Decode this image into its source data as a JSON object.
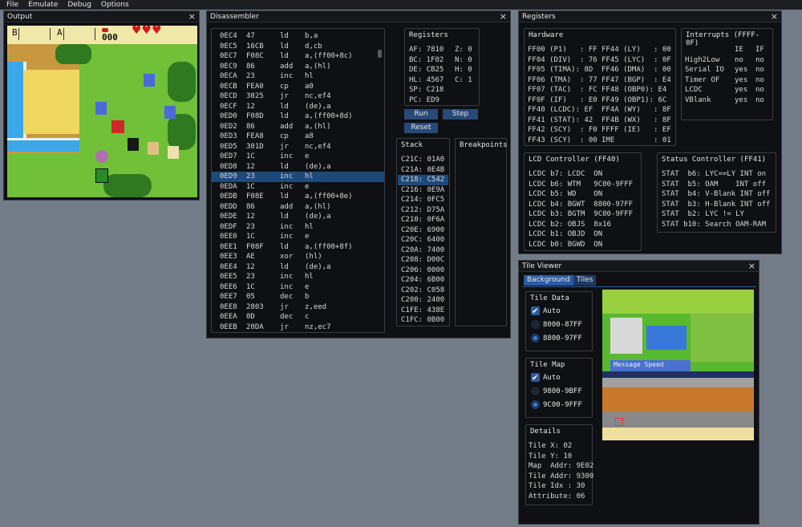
{
  "menu": [
    "File",
    "Emulate",
    "Debug",
    "Options"
  ],
  "output": {
    "title": "Output",
    "close": "×",
    "hud": {
      "b_label": "B",
      "a_label": "A",
      "rupees": "000",
      "hearts": "♥♥♥"
    }
  },
  "disassembler": {
    "title": "Disassembler",
    "close": "×",
    "rows": [
      [
        "0EC4",
        "47",
        "ld",
        "b,a"
      ],
      [
        "0EC5",
        "16CB",
        "ld",
        "d,cb"
      ],
      [
        "0EC7",
        "F08C",
        "ld",
        "a,(ff00+8c)"
      ],
      [
        "0EC9",
        "86",
        "add",
        "a,(hl)"
      ],
      [
        "0ECA",
        "23",
        "inc",
        "hl"
      ],
      [
        "0ECB",
        "FEA0",
        "cp",
        "a0"
      ],
      [
        "0ECD",
        "3025",
        "jr",
        "nc,ef4"
      ],
      [
        "0ECF",
        "12",
        "ld",
        "(de),a"
      ],
      [
        "0ED0",
        "F08D",
        "ld",
        "a,(ff00+8d)"
      ],
      [
        "0ED2",
        "86",
        "add",
        "a,(hl)"
      ],
      [
        "0ED3",
        "FEA8",
        "cp",
        "a8"
      ],
      [
        "0ED5",
        "301D",
        "jr",
        "nc,ef4"
      ],
      [
        "0ED7",
        "1C",
        "inc",
        "e"
      ],
      [
        "0ED8",
        "12",
        "ld",
        "(de),a"
      ],
      [
        "0ED9",
        "23",
        "inc",
        "hl"
      ],
      [
        "0EDA",
        "1C",
        "inc",
        "e"
      ],
      [
        "0EDB",
        "F08E",
        "ld",
        "a,(ff00+8e)"
      ],
      [
        "0EDD",
        "86",
        "add",
        "a,(hl)"
      ],
      [
        "0EDE",
        "12",
        "ld",
        "(de),a"
      ],
      [
        "0EDF",
        "23",
        "inc",
        "hl"
      ],
      [
        "0EE0",
        "1C",
        "inc",
        "e"
      ],
      [
        "0EE1",
        "F08F",
        "ld",
        "a,(ff00+8f)"
      ],
      [
        "0EE3",
        "AE",
        "xor",
        "(hl)"
      ],
      [
        "0EE4",
        "12",
        "ld",
        "(de),a"
      ],
      [
        "0EE5",
        "23",
        "inc",
        "hl"
      ],
      [
        "0EE6",
        "1C",
        "inc",
        "e"
      ],
      [
        "0EE7",
        "05",
        "dec",
        "b"
      ],
      [
        "0EE8",
        "2803",
        "jr",
        "z,eed"
      ],
      [
        "0EEA",
        "0D",
        "dec",
        "c"
      ],
      [
        "0EEB",
        "20DA",
        "jr",
        "nz,ec7"
      ]
    ],
    "selected_index": 14,
    "registers": {
      "title": "Registers",
      "left": [
        "AF: 7810",
        "BC: 1F02",
        "DE: CB25",
        "HL: 4567",
        "SP: C218",
        "PC: ED9"
      ],
      "right": [
        "Z: 0",
        "N: 0",
        "H: 0",
        "C: 1"
      ]
    },
    "buttons": {
      "run": "Run",
      "step": "Step",
      "reset": "Reset"
    },
    "stack": {
      "title": "Stack",
      "rows": [
        "C21C: 01A0",
        "C21A: 0E4B",
        "C218: C542",
        "C216: 0E9A",
        "C214: 0FC5",
        "C212: D75A",
        "C210: 0F6A",
        "C20E: 6900",
        "C20C: 6400",
        "C20A: 7400",
        "C208: D00C",
        "C206: 0000",
        "C204: 6B00",
        "C202: C058",
        "C200: 2400",
        "C1FE: 438E",
        "C1FC: 0B00"
      ],
      "selected_index": 2
    },
    "breakpoints": {
      "title": "Breakpoints"
    }
  },
  "registers_win": {
    "title": "Registers",
    "close": "×",
    "hardware": {
      "title": "Hardware",
      "left": [
        "FF00 (P1)   : FF",
        "FF04 (DIV)  : 76",
        "FF05 (TIMA): 8D",
        "FF06 (TMA)  : 77",
        "FF07 (TAC)  : FC",
        "FF0F (IF)   : E0",
        "FF40 (LCDC): EF",
        "FF41 (STAT): 42",
        "FF42 (SCY)  : F0",
        "FF43 (SCY)  : 00"
      ],
      "right": [
        "FF44 (LY)   : 00",
        "FF45 (LYC)  : 0F",
        "FF46 (DMA)  : 00",
        "FF47 (BGP)  : E4",
        "FF48 (OBP0): E4",
        "FF49 (OBP1): 6C",
        "FF4A (WY)   : 8F",
        "FF4B (WX)   : 8F",
        "FFFF (IE)   : EF",
        "IME         : 01"
      ]
    },
    "interrupts": {
      "title": "Interrupts (FFFF-0F)",
      "headers": [
        "IE",
        "IF"
      ],
      "rows": [
        [
          "High2Low",
          "no",
          "no"
        ],
        [
          "Serial IO",
          "yes",
          "no"
        ],
        [
          "Timer OF",
          "yes",
          "no"
        ],
        [
          "LCDC",
          "yes",
          "no"
        ],
        [
          "VBlank",
          "yes",
          "no"
        ]
      ]
    },
    "lcd": {
      "title": "LCD Controller (FF40)",
      "rows": [
        "LCDC b7: LCDC  ON",
        "LCDC b6: WTM   9C00-9FFF",
        "LCDC b5: WD    ON",
        "LCDC b4: BGWT  8800-97FF",
        "LCDC b3: BGTM  9C00-9FFF",
        "LCDC b2: OBJS  8x16",
        "LCDC b1: OBJD  ON",
        "LCDC b0: BGWD  ON"
      ]
    },
    "status": {
      "title": "Status Controller (FF41)",
      "rows": [
        "STAT  b6: LYC==LY INT on",
        "STAT  b5: OAM    INT off",
        "STAT  b4: V-Blank INT off",
        "STAT  b3: H-Blank INT off",
        "STAT  b2: LYC != LY",
        "STAT b10: Search OAM-RAM"
      ]
    }
  },
  "tile_viewer": {
    "title": "Tile Viewer",
    "close": "×",
    "tabs": [
      "Background",
      "Tiles"
    ],
    "tile_data": {
      "title": "Tile Data",
      "auto": "Auto",
      "options": [
        "8000-87FF",
        "8800-97FF"
      ],
      "selected": 1
    },
    "tile_map": {
      "title": "Tile Map",
      "auto": "Auto",
      "options": [
        "9800-9BFF",
        "9C00-9FFF"
      ],
      "selected": 1
    },
    "details": {
      "title": "Details",
      "rows": [
        "Tile X: 02",
        "Tile Y: 10",
        "Map  Addr: 9E02",
        "Tile Addr: 9300",
        "Tile Idx : 30",
        "Attribute: 06"
      ]
    },
    "preview_banner": "Message Speed"
  }
}
